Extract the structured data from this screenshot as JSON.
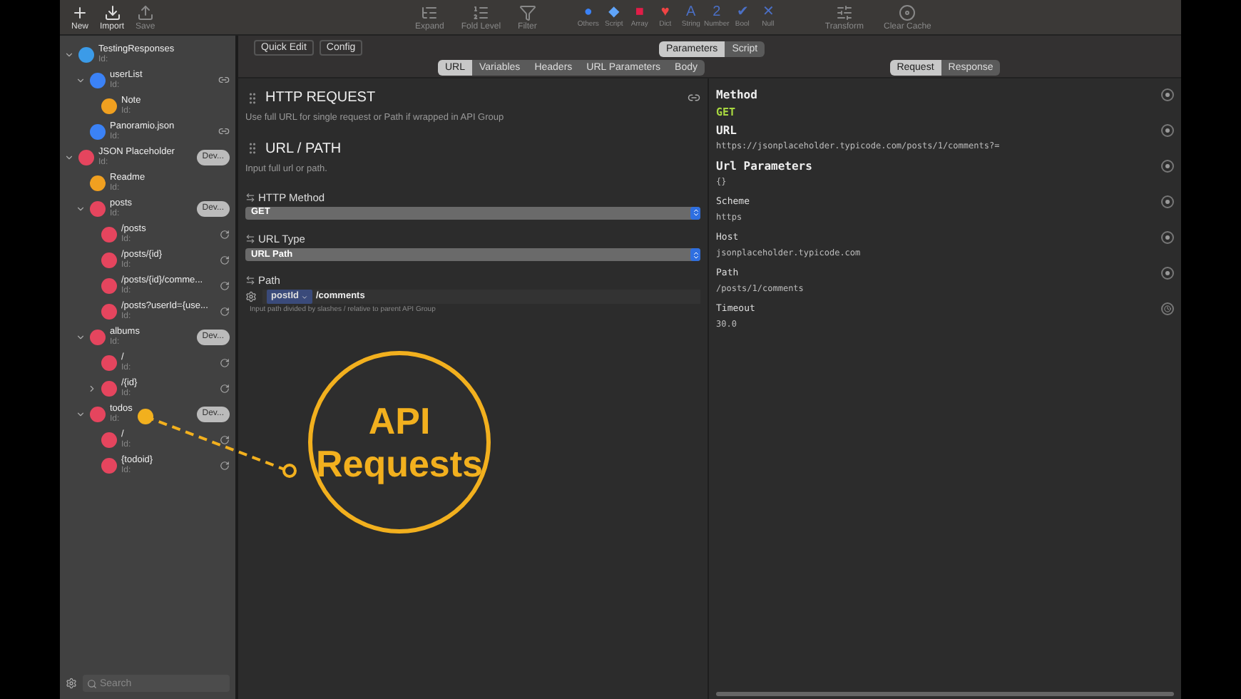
{
  "toolbar": {
    "left": [
      {
        "label": "New",
        "kind": "new"
      },
      {
        "label": "Import",
        "kind": "import"
      },
      {
        "label": "Save",
        "kind": "save"
      }
    ],
    "center": [
      {
        "label": "Expand",
        "kind": "expand"
      },
      {
        "label": "Fold Level",
        "kind": "fold"
      },
      {
        "label": "Filter",
        "kind": "filter"
      }
    ],
    "types": [
      {
        "label": "Others",
        "glyph": "●",
        "color": "#3b82f6"
      },
      {
        "label": "Script",
        "glyph": "◆",
        "color": "#60a5fa"
      },
      {
        "label": "Array",
        "glyph": "■",
        "color": "#e11d48"
      },
      {
        "label": "Dict",
        "glyph": "♥",
        "color": "#ef4444"
      },
      {
        "label": "String",
        "glyph": "A",
        "color": "#4b6fc4"
      },
      {
        "label": "Number",
        "glyph": "2",
        "color": "#4b6fc4"
      },
      {
        "label": "Bool",
        "glyph": "✔",
        "color": "#4b6fc4"
      },
      {
        "label": "Null",
        "glyph": "✕",
        "color": "#4b6fc4"
      }
    ],
    "right": [
      {
        "label": "Transform",
        "kind": "transform"
      },
      {
        "label": "Clear Cache",
        "kind": "cache"
      }
    ]
  },
  "sidebar": {
    "items": [
      {
        "name": "TestingResponses",
        "id_label": "Id:",
        "color": "#3b9be8",
        "expanded": true,
        "children": [
          {
            "name": "userList",
            "id_label": "Id:",
            "color": "#3b82f6",
            "expanded": true,
            "kind": "link",
            "children": [
              {
                "name": "Note",
                "id_label": "Id:",
                "color": "#f0a020"
              }
            ]
          },
          {
            "name": "Panoramio.json",
            "id_label": "Id:",
            "color": "#3b82f6",
            "kind": "link"
          }
        ]
      },
      {
        "name": "JSON Placeholder",
        "id_label": "Id:",
        "color": "#e5455e",
        "expanded": true,
        "badge": "Dev...",
        "children": [
          {
            "name": "Readme",
            "id_label": "Id:",
            "color": "#f0a020"
          },
          {
            "name": "posts",
            "id_label": "Id:",
            "color": "#e5455e",
            "expanded": true,
            "badge": "Dev...",
            "children": [
              {
                "name": "/posts",
                "id_label": "Id:",
                "color": "#e5455e",
                "kind": "request"
              },
              {
                "name": "/posts/{id}",
                "id_label": "Id:",
                "color": "#e5455e",
                "kind": "request"
              },
              {
                "name": "/posts/{id}/comme...",
                "id_label": "Id:",
                "color": "#e5455e",
                "kind": "request"
              },
              {
                "name": "/posts?userId={use...",
                "id_label": "Id:",
                "color": "#e5455e",
                "kind": "request"
              }
            ]
          },
          {
            "name": "albums",
            "id_label": "Id:",
            "color": "#e5455e",
            "expanded": true,
            "badge": "Dev...",
            "children": [
              {
                "name": "/",
                "id_label": "Id:",
                "color": "#e5455e",
                "kind": "request"
              },
              {
                "name": "/{id}",
                "id_label": "Id:",
                "color": "#e5455e",
                "expanded": false,
                "kind": "request"
              }
            ]
          },
          {
            "name": "todos",
            "id_label": "Id:",
            "color": "#e5455e",
            "expanded": true,
            "badge": "Dev...",
            "children": [
              {
                "name": "/",
                "id_label": "Id:",
                "color": "#e5455e",
                "kind": "request"
              },
              {
                "name": "{todoid}",
                "id_label": "Id:",
                "color": "#e5455e",
                "kind": "request"
              }
            ]
          }
        ]
      }
    ],
    "search": {
      "placeholder": "Search"
    }
  },
  "editor": {
    "buttons": [
      "Quick Edit",
      "Config"
    ],
    "mode_tabs": [
      {
        "label": "Parameters",
        "selected": true
      },
      {
        "label": "Script",
        "selected": false
      }
    ],
    "tabs": [
      {
        "label": "URL",
        "selected": true
      },
      {
        "label": "Variables",
        "selected": false
      },
      {
        "label": "Headers",
        "selected": false
      },
      {
        "label": "URL Parameters",
        "selected": false
      },
      {
        "label": "Body",
        "selected": false
      }
    ],
    "sections": [
      {
        "title": "HTTP REQUEST",
        "description": "Use full URL for single request or Path if wrapped in API Group"
      },
      {
        "title": "URL / PATH",
        "description": "Input full url or path."
      }
    ],
    "fields": [
      {
        "kind": "select",
        "label": "HTTP Method",
        "value": "GET"
      },
      {
        "kind": "select",
        "label": "URL Type",
        "value": "URL Path"
      },
      {
        "kind": "path",
        "label": "Path",
        "token": "postId",
        "value": "/comments",
        "hint": "Input path divided by slashes / relative to parent API Group"
      }
    ]
  },
  "preview": {
    "tabs": [
      {
        "label": "Request",
        "selected": true
      },
      {
        "label": "Response",
        "selected": false
      }
    ],
    "rows": [
      {
        "kind": "heading",
        "label": "Method",
        "value": "GET",
        "accent": true
      },
      {
        "kind": "heading",
        "label": "URL",
        "value": "https://jsonplaceholder.typicode.com/posts/1/comments?="
      },
      {
        "kind": "heading",
        "label": "Url Parameters",
        "value": "{}"
      },
      {
        "kind": "field",
        "label": "Scheme",
        "value": "https"
      },
      {
        "kind": "field",
        "label": "Host",
        "value": "jsonplaceholder.typicode.com"
      },
      {
        "kind": "field",
        "label": "Path",
        "value": "/posts/1/comments"
      },
      {
        "kind": "field",
        "label": "Timeout",
        "value": "30.0"
      }
    ]
  },
  "callout": {
    "text_lines": [
      "API",
      "Requests"
    ]
  }
}
